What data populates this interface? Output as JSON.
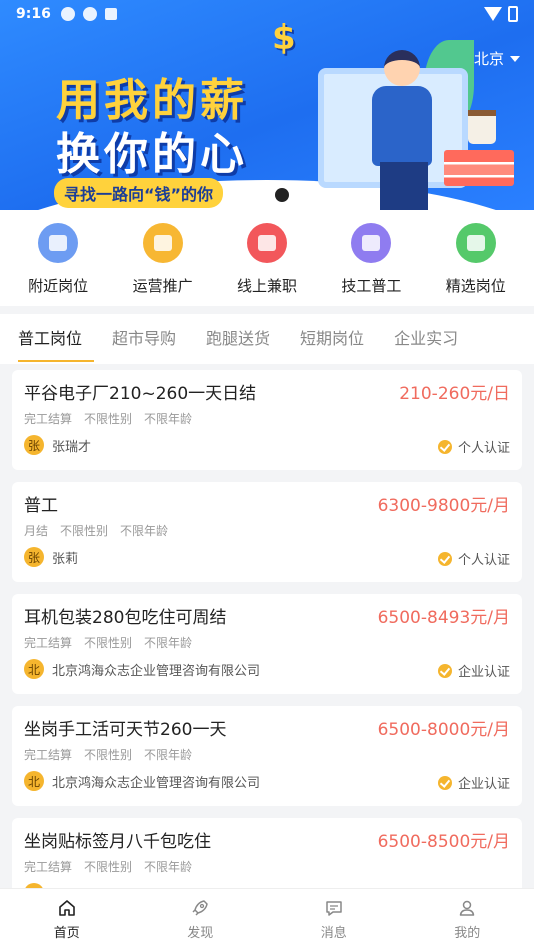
{
  "status_bar": {
    "time": "9:16"
  },
  "banner": {
    "slogan_line1": "用我的薪",
    "slogan_line2": "换你的心",
    "subtitle": "寻找一路向“钱”的你",
    "dollar_sign": "$"
  },
  "location": {
    "city": "北京"
  },
  "categories": [
    {
      "label": "附近岗位",
      "icon": "building-icon",
      "color": "#6d9cf2"
    },
    {
      "label": "运营推广",
      "icon": "coins-icon",
      "color": "#f7b733"
    },
    {
      "label": "线上兼职",
      "icon": "layers-icon",
      "color": "#f2575b"
    },
    {
      "label": "技工普工",
      "icon": "card-icon",
      "color": "#8f7cf0"
    },
    {
      "label": "精选岗位",
      "icon": "trophy-icon",
      "color": "#55c96a"
    }
  ],
  "tabs": [
    {
      "label": "普工岗位",
      "active": true
    },
    {
      "label": "超市导购"
    },
    {
      "label": "跑腿送货"
    },
    {
      "label": "短期岗位"
    },
    {
      "label": "企业实习"
    }
  ],
  "jobs": [
    {
      "title": "平谷电子厂210~260一天日结",
      "salary": "210-260元/日",
      "tags": [
        "完工结算",
        "不限性别",
        "不限年龄"
      ],
      "avatar": "张",
      "poster": "张瑞才",
      "verify": "个人认证"
    },
    {
      "title": "普工",
      "salary": "6300-9800元/月",
      "tags": [
        "月结",
        "不限性别",
        "不限年龄"
      ],
      "avatar": "张",
      "poster": "张莉",
      "verify": "个人认证"
    },
    {
      "title": "耳机包装280包吃住可周结",
      "salary": "6500-8493元/月",
      "tags": [
        "完工结算",
        "不限性别",
        "不限年龄"
      ],
      "avatar": "北",
      "poster": "北京鸿海众志企业管理咨询有限公司",
      "verify": "企业认证"
    },
    {
      "title": "坐岗手工活可天节260一天",
      "salary": "6500-8000元/月",
      "tags": [
        "完工结算",
        "不限性别",
        "不限年龄"
      ],
      "avatar": "北",
      "poster": "北京鸿海众志企业管理咨询有限公司",
      "verify": "企业认证"
    },
    {
      "title": "坐岗贴标签月八千包吃住",
      "salary": "6500-8500元/月",
      "tags": [
        "完工结算",
        "不限性别",
        "不限年龄"
      ],
      "avatar": "北",
      "poster": "",
      "verify": ""
    }
  ],
  "bottom_nav": [
    {
      "label": "首页",
      "icon": "home-icon",
      "active": true
    },
    {
      "label": "发现",
      "icon": "rocket-icon"
    },
    {
      "label": "消息",
      "icon": "message-icon"
    },
    {
      "label": "我的",
      "icon": "user-icon"
    }
  ]
}
